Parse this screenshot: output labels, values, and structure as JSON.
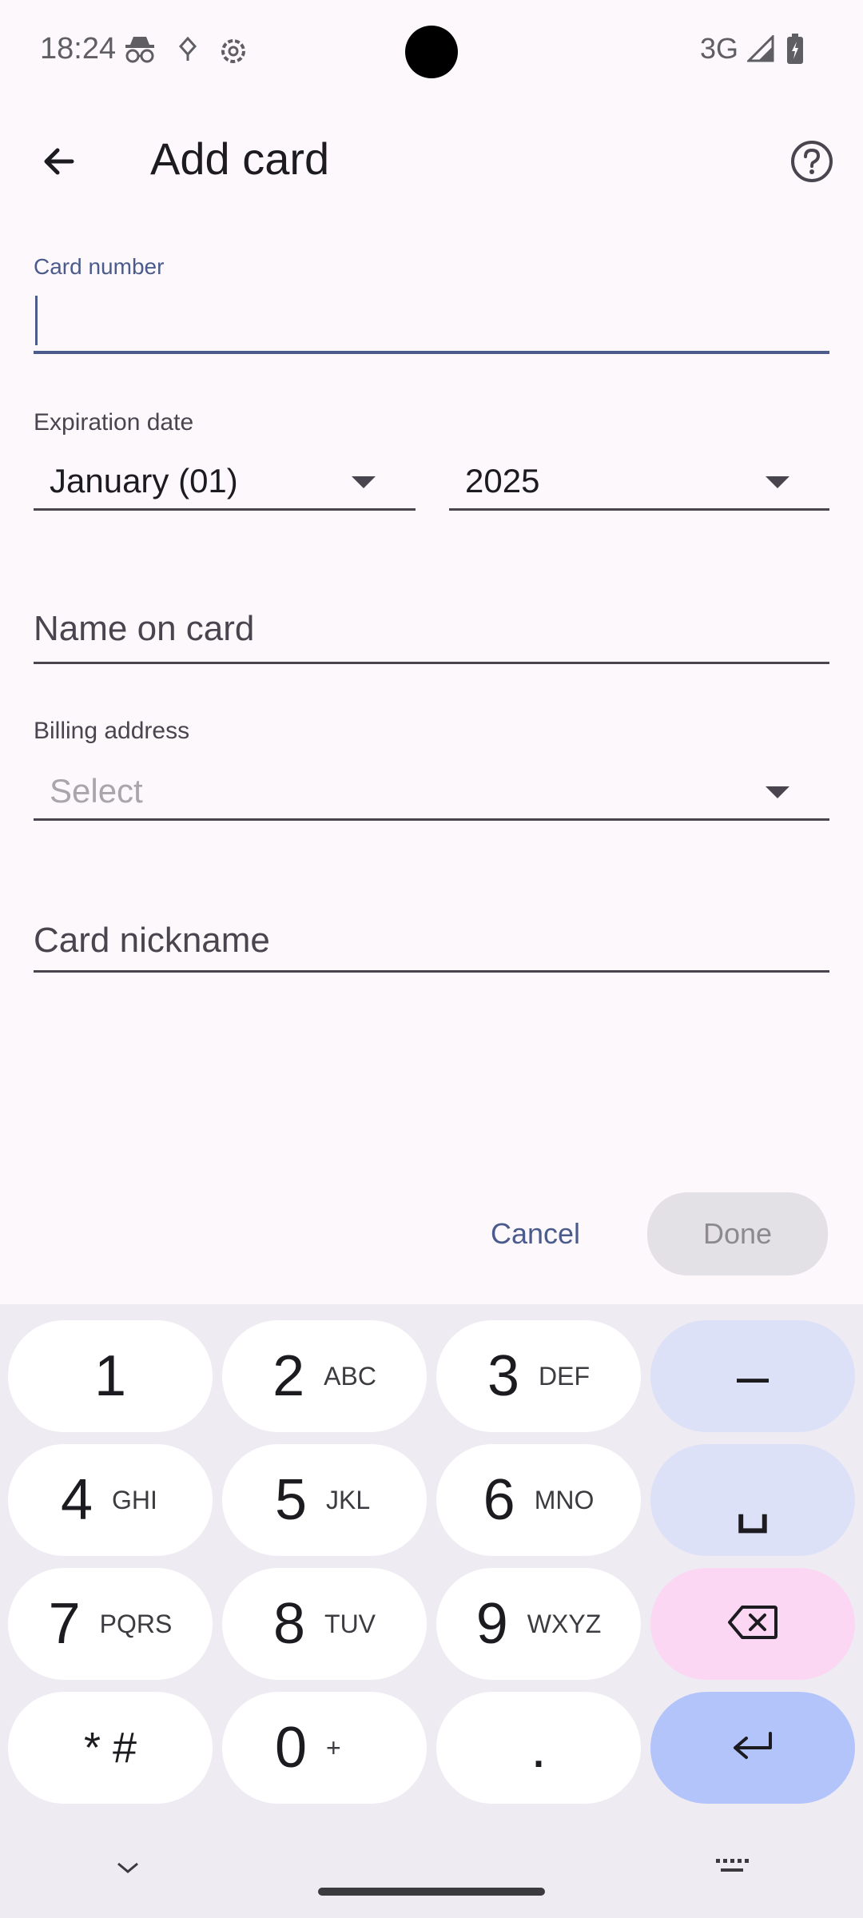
{
  "status_bar": {
    "time": "18:24",
    "network": "3G"
  },
  "app_bar": {
    "title": "Add card"
  },
  "form": {
    "card_number": {
      "label": "Card number",
      "value": ""
    },
    "expiration": {
      "label": "Expiration date",
      "month": "January (01)",
      "year": "2025"
    },
    "name_on_card": {
      "placeholder": "Name on card"
    },
    "billing": {
      "label": "Billing address",
      "placeholder": "Select"
    },
    "nickname": {
      "placeholder": "Card nickname"
    }
  },
  "actions": {
    "cancel": "Cancel",
    "done": "Done"
  },
  "keyboard": {
    "rows": [
      [
        {
          "main": "1",
          "sub": ""
        },
        {
          "main": "2",
          "sub": "ABC"
        },
        {
          "main": "3",
          "sub": "DEF"
        },
        {
          "main": "–",
          "sub": "",
          "style": "act"
        }
      ],
      [
        {
          "main": "4",
          "sub": "GHI"
        },
        {
          "main": "5",
          "sub": "JKL"
        },
        {
          "main": "6",
          "sub": "MNO"
        },
        {
          "main": "␣",
          "sub": "",
          "style": "act"
        }
      ],
      [
        {
          "main": "7",
          "sub": "PQRS"
        },
        {
          "main": "8",
          "sub": "TUV"
        },
        {
          "main": "9",
          "sub": "WXYZ"
        },
        {
          "main": "",
          "sub": "",
          "style": "del",
          "icon": "backspace-icon"
        }
      ],
      [
        {
          "main": "* #",
          "sub": ""
        },
        {
          "main": "0",
          "sub": "+"
        },
        {
          "main": ".",
          "sub": ""
        },
        {
          "main": "",
          "sub": "",
          "style": "ent",
          "icon": "enter-icon"
        }
      ]
    ]
  },
  "colors": {
    "accent": "#4a5b8c",
    "background": "#fdf8fc",
    "delete_key": "#fbd7f4",
    "enter_key": "#b3c4fb"
  }
}
